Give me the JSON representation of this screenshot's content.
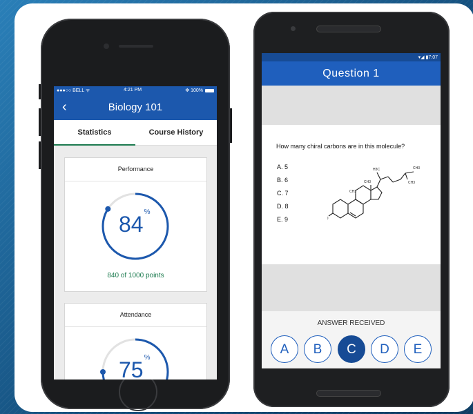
{
  "ios": {
    "status": {
      "carrier": "●●●○○ BELL ᯤ",
      "time": "4:21 PM",
      "battery": "✻ 100%"
    },
    "nav_title": "Biology 101",
    "back_glyph": "‹",
    "tabs": [
      {
        "label": "Statistics",
        "active": true
      },
      {
        "label": "Course History",
        "active": false
      }
    ],
    "performance": {
      "title": "Performance",
      "value": "84",
      "unit": "%",
      "fraction": 0.84,
      "footer": "840 of 1000 points"
    },
    "attendance": {
      "title": "Attendance",
      "value": "75",
      "unit": "%",
      "fraction": 0.75
    }
  },
  "android": {
    "status": {
      "icons": "▾◢ ▮7:07"
    },
    "title": "Question 1",
    "question": "How many chiral carbons are in this molecule?",
    "options": [
      "A. 5",
      "B. 6",
      "C. 7",
      "D. 8",
      "E. 9"
    ],
    "molecule_labels": {
      "h3c": "H3C",
      "ch3_a": "CH3",
      "ch3_b": "CH3",
      "ch3_c": "CH3",
      "ch3_d": "CH3",
      "ho": "HO"
    },
    "answer_label": "ANSWER RECEIVED",
    "answers": [
      {
        "label": "A",
        "selected": false
      },
      {
        "label": "B",
        "selected": false
      },
      {
        "label": "C",
        "selected": true
      },
      {
        "label": "D",
        "selected": false
      },
      {
        "label": "E",
        "selected": false
      }
    ]
  },
  "colors": {
    "ios_blue": "#1c58ad",
    "android_blue": "#1f5fbd",
    "selected": "#174b95",
    "green": "#1b7a4e"
  }
}
